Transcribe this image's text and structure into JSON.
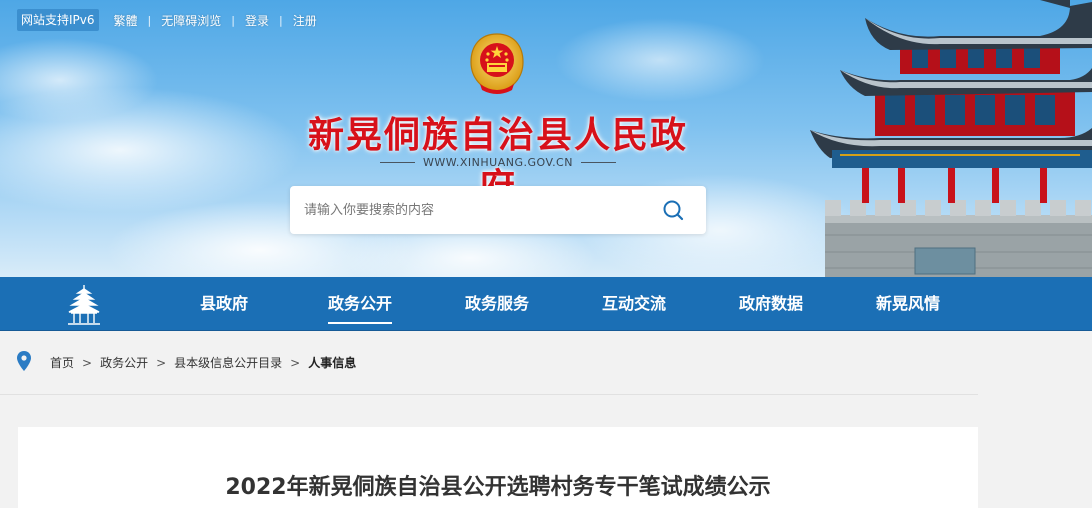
{
  "top_links": {
    "ipv6_badge": "网站支持IPv6",
    "traditional": "繁體",
    "accessible": "无障碍浏览",
    "login": "登录",
    "register": "注册",
    "separator": "|"
  },
  "site": {
    "title": "新晃侗族自治县人民政府",
    "domain": "WWW.XINHUANG.GOV.CN"
  },
  "search": {
    "placeholder": "请输入你要搜索的内容",
    "icon": "search-icon"
  },
  "nav": {
    "items": [
      {
        "label": "县政府",
        "active": false
      },
      {
        "label": "政务公开",
        "active": true
      },
      {
        "label": "政务服务",
        "active": false
      },
      {
        "label": "互动交流",
        "active": false
      },
      {
        "label": "政府数据",
        "active": false
      },
      {
        "label": "新晃风情",
        "active": false
      }
    ]
  },
  "breadcrumb": {
    "icon": "location-pin-icon",
    "arrow": ">",
    "items": [
      "首页",
      "政务公开",
      "县本级信息公开目录",
      "人事信息"
    ]
  },
  "article": {
    "title": "2022年新晃侗族自治县公开选聘村务专干笔试成绩公示"
  },
  "colors": {
    "nav_bg": "#1b6fb5",
    "title_red": "#d7111a",
    "sky_top": "#4ea7e6"
  }
}
